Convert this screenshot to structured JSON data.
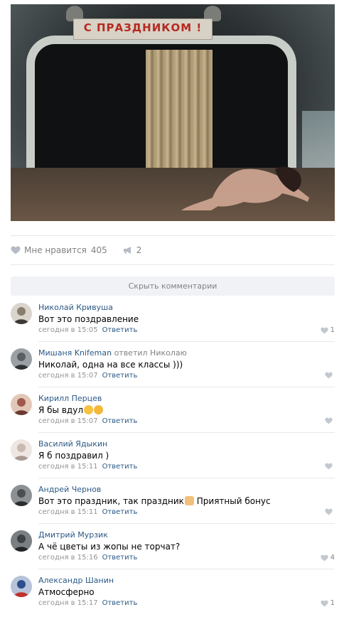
{
  "photo": {
    "banner_text": "С ПРАЗДНИКОМ !"
  },
  "actions": {
    "like_label": "Мне нравится",
    "like_count": "405",
    "share_count": "2"
  },
  "hide_comments_label": "Скрыть комментарии",
  "comments": [
    {
      "author": "Николай Кривуша",
      "reply_to_verb": "",
      "reply_to_name": "",
      "text": "Вот это поздравление",
      "time": "сегодня в 15:05",
      "reply_label": "Ответить",
      "likes": "1",
      "avatar_color": "#8a7d6c"
    },
    {
      "author": "Мишаня Knifeman",
      "reply_to_verb": "ответил",
      "reply_to_name": "Николаю",
      "text": "Николай, одна на все классы )))",
      "time": "сегодня в 15:07",
      "reply_label": "Ответить",
      "likes": "",
      "avatar_color": "#5b5f63"
    },
    {
      "author": "Кирилл Перцев",
      "reply_to_verb": "",
      "reply_to_name": "",
      "text": "Я бы вдул",
      "time": "сегодня в 15:07",
      "reply_label": "Ответить",
      "likes": "",
      "avatar_color": "#a0584a"
    },
    {
      "author": "Василий Ядыкин",
      "reply_to_verb": "",
      "reply_to_name": "",
      "text": "Я б поздравил )",
      "time": "сегодня в 15:11",
      "reply_label": "Ответить",
      "likes": "",
      "avatar_color": "#c9b9b0"
    },
    {
      "author": "Андрей Чернов",
      "reply_to_verb": "",
      "reply_to_name": "",
      "text": "Вот это праздник, так праздник",
      "text_after": "Приятный бонус",
      "time": "сегодня в 15:11",
      "reply_label": "Ответить",
      "likes": "",
      "avatar_color": "#4b4f52"
    },
    {
      "author": "Дмитрий Мурзик",
      "reply_to_verb": "",
      "reply_to_name": "",
      "text": "А чё цветы из жопы не торчат?",
      "time": "сегодня в 15:16",
      "reply_label": "Ответить",
      "likes": "4",
      "avatar_color": "#3e4245"
    },
    {
      "author": "Александр Шанин",
      "reply_to_verb": "",
      "reply_to_name": "",
      "text": "Атмосферно",
      "time": "сегодня в 15:17",
      "reply_label": "Ответить",
      "likes": "1",
      "avatar_color": "#2c4f8c"
    }
  ],
  "colors": {
    "link": "#2a5885",
    "muted": "#828282",
    "divider": "#e7e8ec",
    "button_bg": "#f0f2f5",
    "banner_red": "#b52a20"
  }
}
